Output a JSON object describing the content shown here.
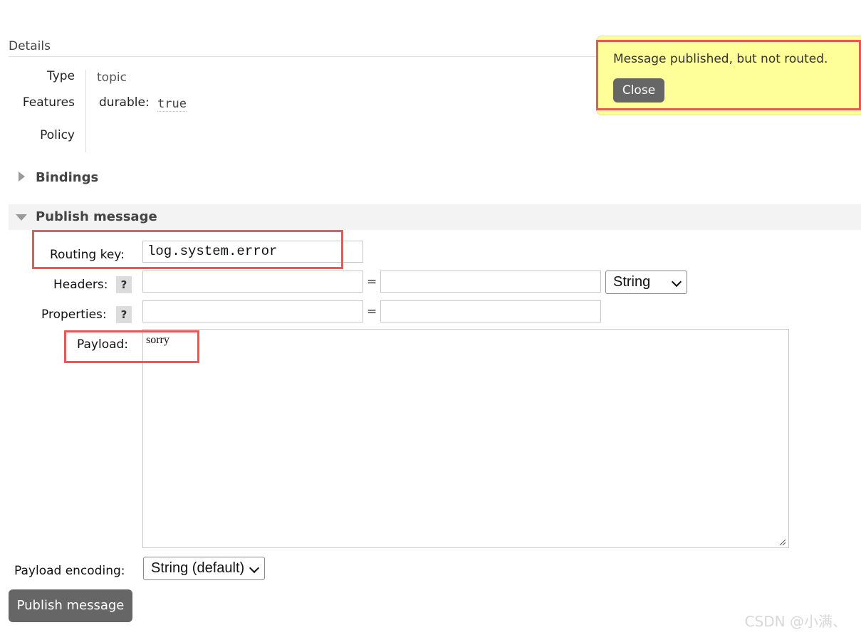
{
  "details": {
    "title": "Details",
    "type_label": "Type",
    "type_value": "topic",
    "features_label": "Features",
    "features_key": "durable:",
    "features_value": "true",
    "policy_label": "Policy"
  },
  "sections": {
    "bindings": "Bindings",
    "publish": "Publish message"
  },
  "form": {
    "routing_key_label": "Routing key:",
    "routing_key_value": "log.system.error",
    "headers_label": "Headers:",
    "properties_label": "Properties:",
    "help_glyph": "?",
    "equals": "=",
    "header_type": "String",
    "payload_label": "Payload:",
    "payload_value": "sorry",
    "encoding_label": "Payload encoding:",
    "encoding_value": "String (default)",
    "publish_button": "Publish message"
  },
  "notification": {
    "message": "Message published, but not routed.",
    "close_button": "Close"
  },
  "watermark": "CSDN @小满、",
  "colors": {
    "highlight": "#ee5555",
    "notice_bg": "#ffff99",
    "button_bg": "#666666"
  }
}
